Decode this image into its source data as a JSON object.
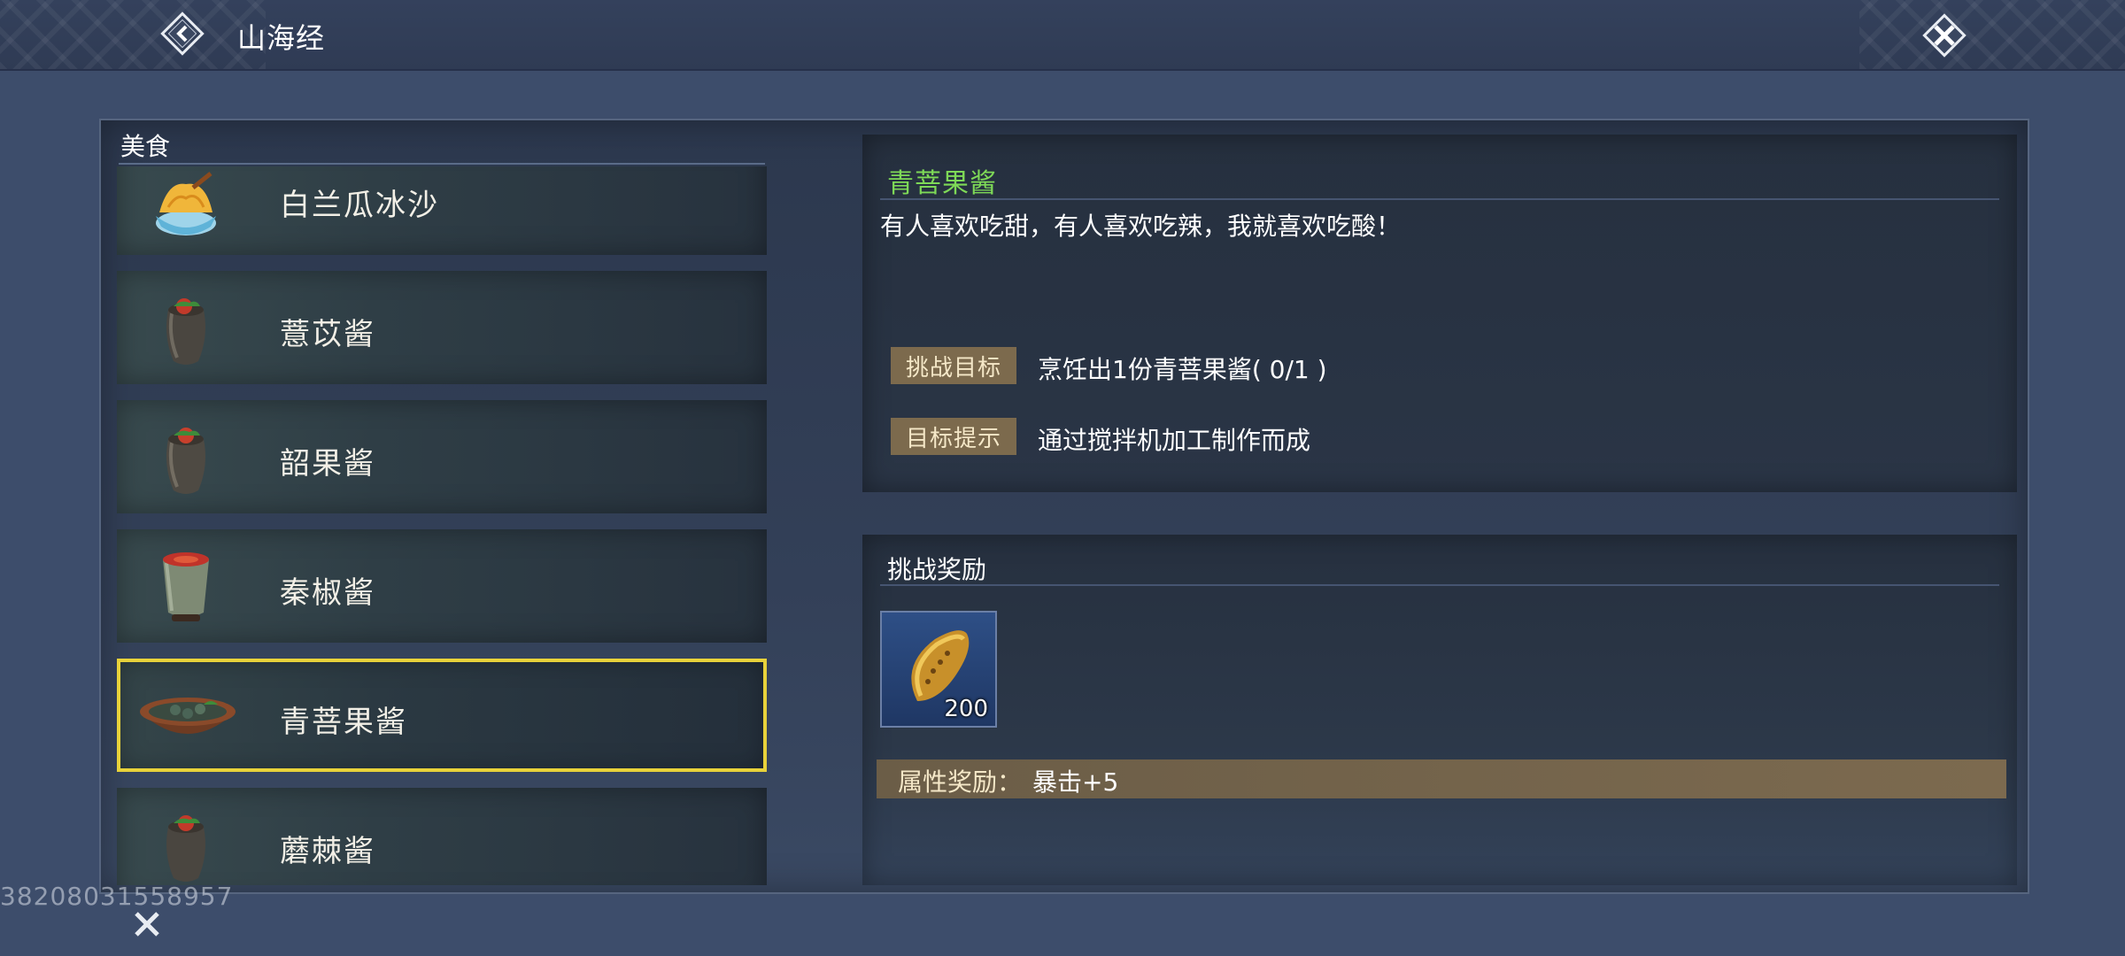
{
  "header": {
    "title": "山海经",
    "back_icon": "chevron-left-icon",
    "close_icon": "close-icon"
  },
  "list": {
    "section_title": "美食",
    "items": [
      {
        "label": "白兰瓜冰沙",
        "icon": "shaved-ice-bowl-icon"
      },
      {
        "label": "薏苡酱",
        "icon": "clay-jar-icon"
      },
      {
        "label": "韶果酱",
        "icon": "clay-jar-icon"
      },
      {
        "label": "秦椒酱",
        "icon": "sauce-cup-icon"
      },
      {
        "label": "青菩果酱",
        "icon": "dish-bowl-icon",
        "selected": true
      },
      {
        "label": "蘑棘酱",
        "icon": "clay-jar-icon"
      }
    ]
  },
  "detail": {
    "title": "青菩果酱",
    "description": "有人喜欢吃甜，有人喜欢吃辣，我就喜欢吃酸！",
    "goal_tag": "挑战目标",
    "goal_text": "烹饪出1份青菩果酱( 0/1 )",
    "hint_tag": "目标提示",
    "hint_text": "通过搅拌机加工制作而成"
  },
  "reward": {
    "title": "挑战奖励",
    "item_icon": "golden-seed-icon",
    "item_count": "200",
    "attr_label": "属性奖励：",
    "attr_value": "暴击+5"
  },
  "footer": {
    "uid": "38208031558957",
    "close_icon": "close-icon"
  },
  "colors": {
    "accent_green": "#7ed957",
    "selected_border": "#e8d23a",
    "tag_bg": "#7c6a4d"
  }
}
